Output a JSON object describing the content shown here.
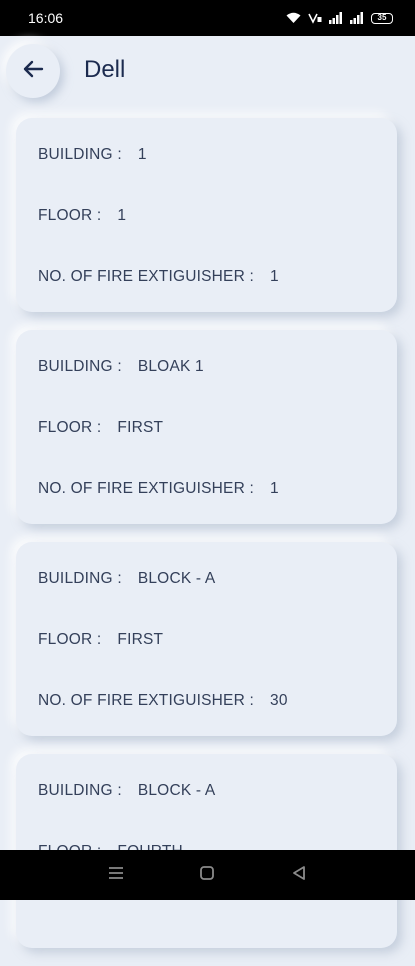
{
  "status_bar": {
    "time": "16:06",
    "battery": "35"
  },
  "header": {
    "title": "Dell",
    "back_icon": "arrow-left-icon"
  },
  "records": [
    {
      "building_label": "BUILDING :",
      "building": "1",
      "floor_label": "FLOOR :",
      "floor": "1",
      "fire_label": "NO. OF FIRE EXTIGUISHER :",
      "fire": "1"
    },
    {
      "building_label": "BUILDING :",
      "building": "BLOAK 1",
      "floor_label": "FLOOR :",
      "floor": "FIRST",
      "fire_label": "NO. OF FIRE EXTIGUISHER :",
      "fire": "1"
    },
    {
      "building_label": "BUILDING :",
      "building": "BLOCK - A",
      "floor_label": "FLOOR :",
      "floor": "FIRST",
      "fire_label": "NO. OF FIRE EXTIGUISHER :",
      "fire": "30"
    },
    {
      "building_label": "BUILDING :",
      "building": "BLOCK - A",
      "floor_label": "FLOOR :",
      "floor": "FOURTH",
      "fire_label": "",
      "fire": ""
    }
  ],
  "nav": {
    "menu_icon": "menu-icon",
    "home_icon": "home-square-icon",
    "back_icon": "triangle-back-icon"
  }
}
